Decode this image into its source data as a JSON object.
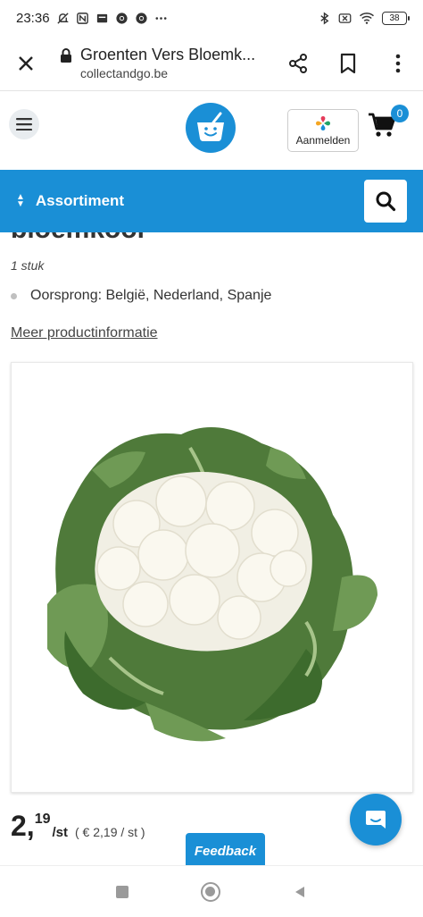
{
  "status_bar": {
    "time": "23:36",
    "battery": "38",
    "icons": [
      "mute-notification-icon",
      "nfc-icon",
      "app-icon",
      "chrome-icon",
      "chrome-icon",
      "more-dots-icon",
      "bluetooth-icon",
      "no-sim-icon",
      "wifi-icon",
      "battery-icon"
    ]
  },
  "browser": {
    "title": "Groenten Vers Bloemk...",
    "url": "collectandgo.be",
    "icons": [
      "close-icon",
      "lock-icon",
      "share-icon",
      "bookmark-icon",
      "more-vert-icon"
    ]
  },
  "header": {
    "login_label": "Aanmelden",
    "cart_count": "0",
    "brand_color": "#1a8fd6"
  },
  "assortment": {
    "label": "Assortiment"
  },
  "product": {
    "name": "bloemkool",
    "quantity": "1 stuk",
    "origin": "Oorsprong: België, Nederland, Spanje",
    "more_info": "Meer productinformatie",
    "price_int": "2,",
    "price_dec": "19",
    "price_unit": "/st",
    "price_per_unit": "( € 2,19 / st )"
  },
  "feedback": {
    "label": "Feedback"
  }
}
